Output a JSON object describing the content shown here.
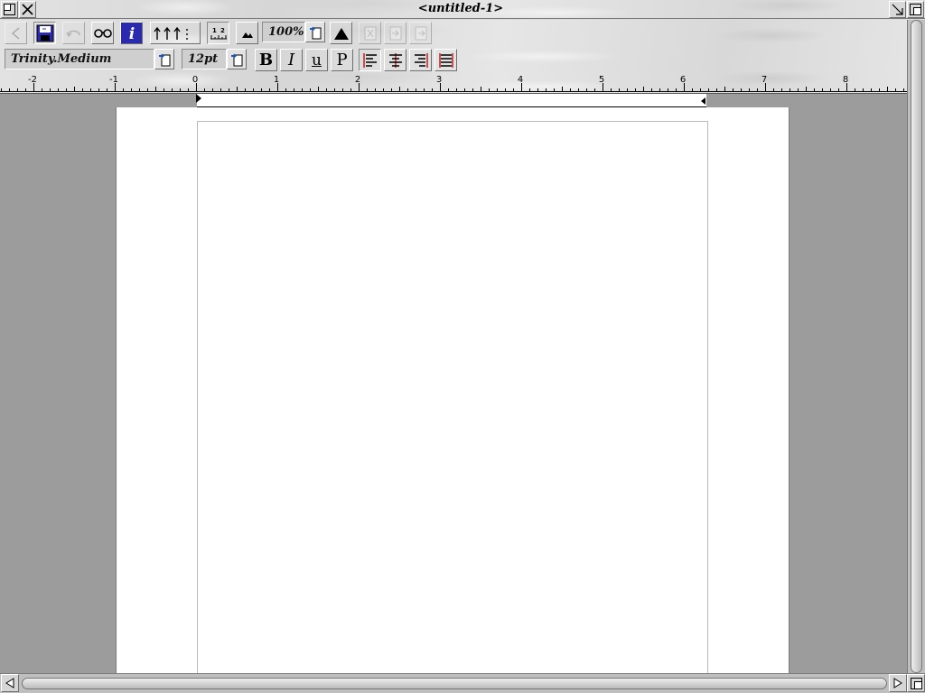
{
  "window": {
    "title": "<untitled-1>"
  },
  "toolbar": {
    "buttons": [
      {
        "name": "back-button",
        "icon": "left-arrow-icon",
        "enabled": false
      },
      {
        "name": "save-button",
        "icon": "floppy-disk-icon",
        "enabled": true
      },
      {
        "name": "undo-button",
        "icon": "undo-icon",
        "enabled": false
      },
      {
        "name": "find-button",
        "icon": "binoculars-icon",
        "enabled": true
      },
      {
        "name": "info-button",
        "icon": "info-icon",
        "enabled": true
      },
      {
        "name": "tabs-button",
        "icon": "tab-stops-icon",
        "enabled": true
      },
      {
        "name": "ruler-button",
        "icon": "ruler-icon",
        "enabled": true
      },
      {
        "name": "zoom-out-button",
        "icon": "small-mountain-icon",
        "enabled": true
      },
      {
        "name": "zoom-in-button",
        "icon": "large-mountain-icon",
        "enabled": true
      },
      {
        "name": "cut-button",
        "icon": "scissors-icon",
        "enabled": false
      },
      {
        "name": "copy-button",
        "icon": "copy-icon",
        "enabled": false
      },
      {
        "name": "paste-button",
        "icon": "paste-icon",
        "enabled": false
      }
    ],
    "zoom": "100%",
    "font_name": "Trinity.Medium",
    "font_size": "12pt",
    "bold_label": "B",
    "italic_label": "I",
    "underline_label": "u",
    "plain_label": "P",
    "align_buttons": [
      "align-left",
      "align-centre",
      "align-right",
      "align-justify"
    ]
  },
  "ruler": {
    "labels": [
      "-2",
      "-1",
      "0",
      "1",
      "2",
      "3",
      "4",
      "5",
      "6",
      "7",
      "8"
    ]
  },
  "colors": {
    "workspace_gray": "#9c9c9c",
    "align_active_red": "#c02020",
    "info_blue": "#2a2ab0"
  }
}
